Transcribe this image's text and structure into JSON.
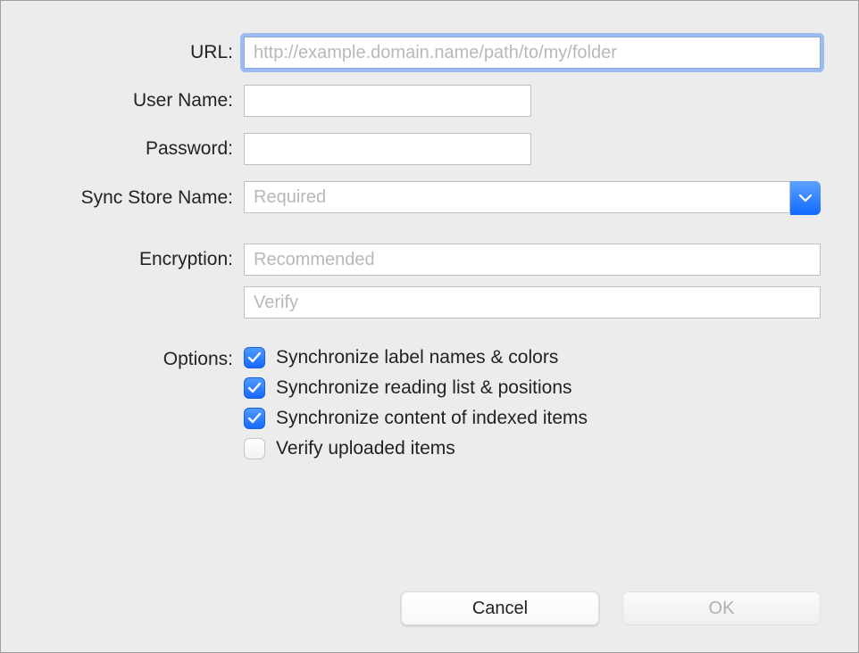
{
  "labels": {
    "url": "URL:",
    "username": "User Name:",
    "password": "Password:",
    "syncstore": "Sync Store Name:",
    "encryption": "Encryption:",
    "options": "Options:"
  },
  "placeholders": {
    "url": "http://example.domain.name/path/to/my/folder",
    "syncstore": "Required",
    "encryption": "Recommended",
    "verify": "Verify"
  },
  "values": {
    "url": "",
    "username": "",
    "password": "",
    "syncstore": "",
    "encryption": "",
    "verify": ""
  },
  "options": {
    "sync_labels": {
      "label": "Synchronize label names & colors",
      "checked": true
    },
    "sync_reading": {
      "label": "Synchronize reading list & positions",
      "checked": true
    },
    "sync_content": {
      "label": "Synchronize content of indexed items",
      "checked": true
    },
    "verify_uploaded": {
      "label": "Verify uploaded items",
      "checked": false
    }
  },
  "buttons": {
    "cancel": "Cancel",
    "ok": "OK"
  }
}
